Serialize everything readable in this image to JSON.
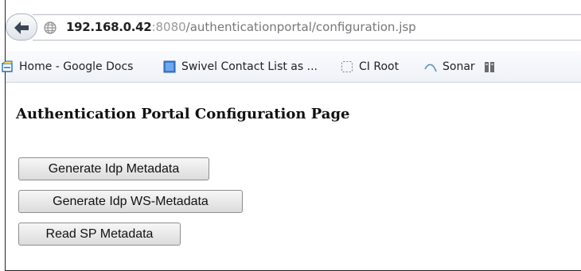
{
  "browser": {
    "url": {
      "host": "192.168.0.42",
      "port": ":8080",
      "path": "/authenticationportal/configuration.jsp"
    },
    "bookmarks": [
      {
        "label": "Home - Google Docs",
        "icon": "google-docs-icon"
      },
      {
        "label": "Swivel Contact List as ...",
        "icon": "document-icon"
      },
      {
        "label": "CI Root",
        "icon": "dashed-box-icon"
      },
      {
        "label": "Sonar",
        "icon": "sonar-icon"
      },
      {
        "label": "",
        "icon": "bookmark-icon"
      }
    ]
  },
  "page": {
    "title": "Authentication Portal Configuration Page",
    "buttons": [
      {
        "label": "Generate Idp Metadata"
      },
      {
        "label": "Generate Idp WS-Metadata"
      },
      {
        "label": "Read SP Metadata"
      }
    ]
  }
}
